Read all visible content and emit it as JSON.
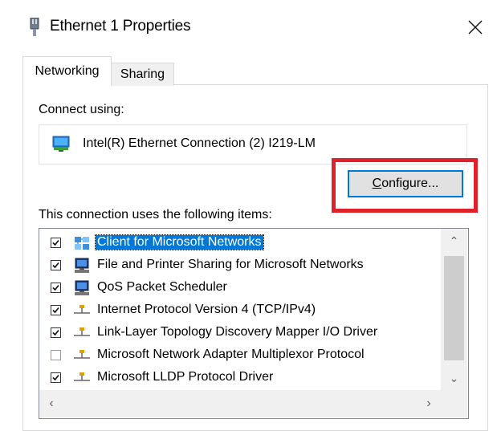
{
  "window": {
    "title": "Ethernet 1 Properties",
    "title_icon": "network-adapter-icon",
    "close_icon": "close-icon"
  },
  "tabs": [
    {
      "label": "Networking",
      "active": true
    },
    {
      "label": "Sharing",
      "active": false
    }
  ],
  "connect_using": {
    "label": "Connect using:",
    "adapter_name": "Intel(R) Ethernet Connection (2) I219-LM",
    "adapter_icon": "network-card-icon"
  },
  "configure_button": {
    "label_mnemonic": "C",
    "label_rest": "onfigure...",
    "highlight_color": "#e0202a"
  },
  "items_section": {
    "label": "This connection uses the following items:",
    "items": [
      {
        "label": "Client for Microsoft Networks",
        "checked": true,
        "selected": true,
        "icon": "network-client-icon"
      },
      {
        "label": "File and Printer Sharing for Microsoft Networks",
        "checked": true,
        "selected": false,
        "icon": "computer-service-icon"
      },
      {
        "label": "QoS Packet Scheduler",
        "checked": true,
        "selected": false,
        "icon": "computer-service-icon"
      },
      {
        "label": "Internet Protocol Version 4 (TCP/IPv4)",
        "checked": true,
        "selected": false,
        "icon": "protocol-icon"
      },
      {
        "label": "Link-Layer Topology Discovery Mapper I/O Driver",
        "checked": true,
        "selected": false,
        "icon": "protocol-icon"
      },
      {
        "label": "Microsoft Network Adapter Multiplexor Protocol",
        "checked": false,
        "selected": false,
        "icon": "protocol-icon"
      },
      {
        "label": "Microsoft LLDP Protocol Driver",
        "checked": true,
        "selected": false,
        "icon": "protocol-icon"
      }
    ]
  },
  "colors": {
    "accent": "#0078d7",
    "selection_bg": "#0078d7",
    "highlight": "#e0202a"
  }
}
